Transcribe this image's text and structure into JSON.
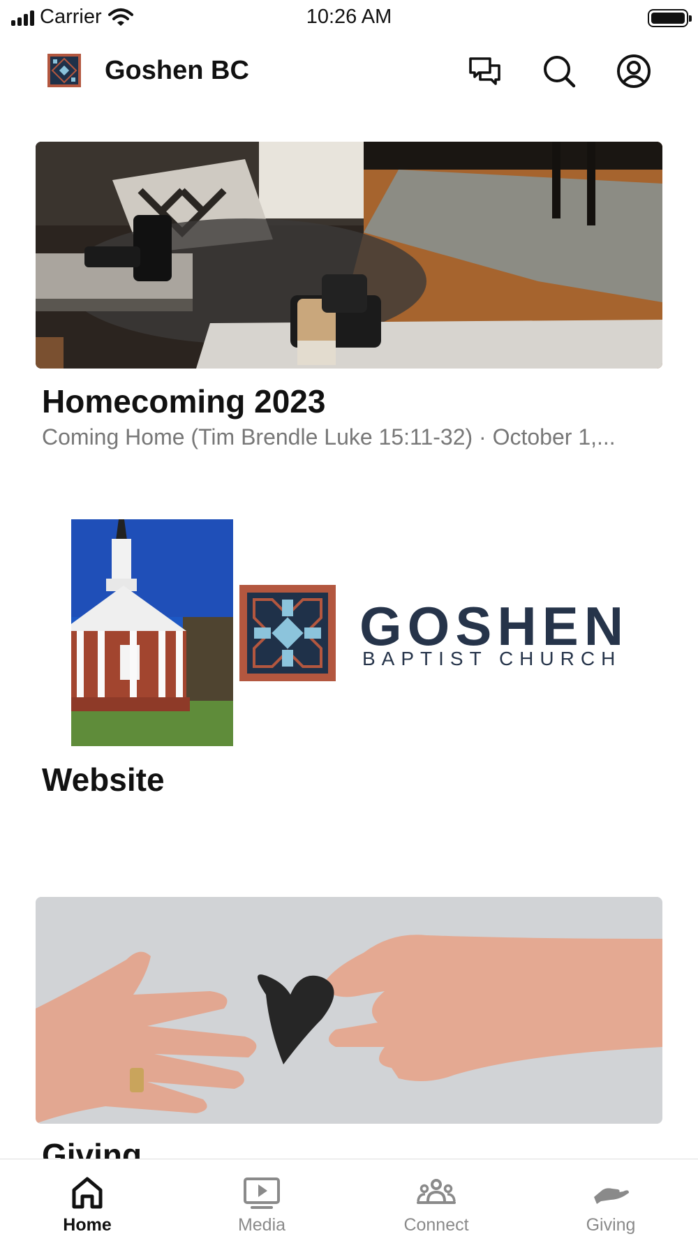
{
  "status_bar": {
    "carrier": "Carrier",
    "time": "10:26 AM"
  },
  "header": {
    "title": "Goshen BC",
    "icons": [
      "chat-icon",
      "search-icon",
      "profile-icon"
    ]
  },
  "cards": [
    {
      "title": "Homecoming 2023",
      "subtitle": "Coming Home (Tim Brendle Luke 15:11-32) · October 1,..."
    },
    {
      "title": "Website",
      "logo_word": "GOSHEN",
      "logo_sub": "BAPTIST CHURCH",
      "church_sign": "GOSHEN BAPTIST CHURCH"
    },
    {
      "title": "Giving"
    }
  ],
  "tabs": [
    {
      "label": "Home",
      "icon": "home-icon",
      "active": true
    },
    {
      "label": "Media",
      "icon": "media-icon",
      "active": false
    },
    {
      "label": "Connect",
      "icon": "connect-icon",
      "active": false
    },
    {
      "label": "Giving",
      "icon": "giving-icon",
      "active": false
    }
  ],
  "colors": {
    "brand_orange": "#b3573f",
    "brand_navy": "#1f3149",
    "brand_light_blue": "#8cc4dc",
    "inactive_tab": "#8a8a8a"
  }
}
